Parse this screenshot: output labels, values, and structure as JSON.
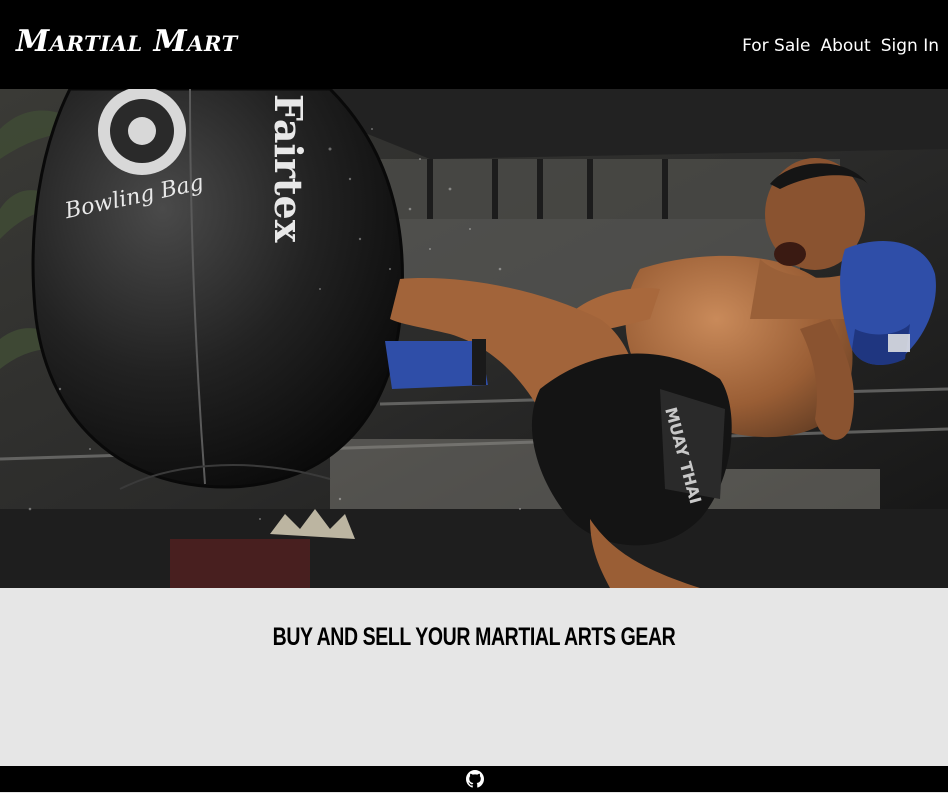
{
  "navbar": {
    "brand": "Martial Mart",
    "links": [
      "For Sale",
      "About",
      "Sign In"
    ]
  },
  "hero": {
    "bag_brand_script": "Bowling Bag",
    "bag_brand_vertical": "Fairtex",
    "shorts_text": "MUAY THAI"
  },
  "main": {
    "tagline": "Buy and Sell Your Martial Arts Gear"
  },
  "footer": {
    "icon": "github-icon"
  },
  "colors": {
    "navbar": "#000000",
    "content_bg": "#e6e6e6",
    "glove_blue": "#2f4ea8"
  }
}
